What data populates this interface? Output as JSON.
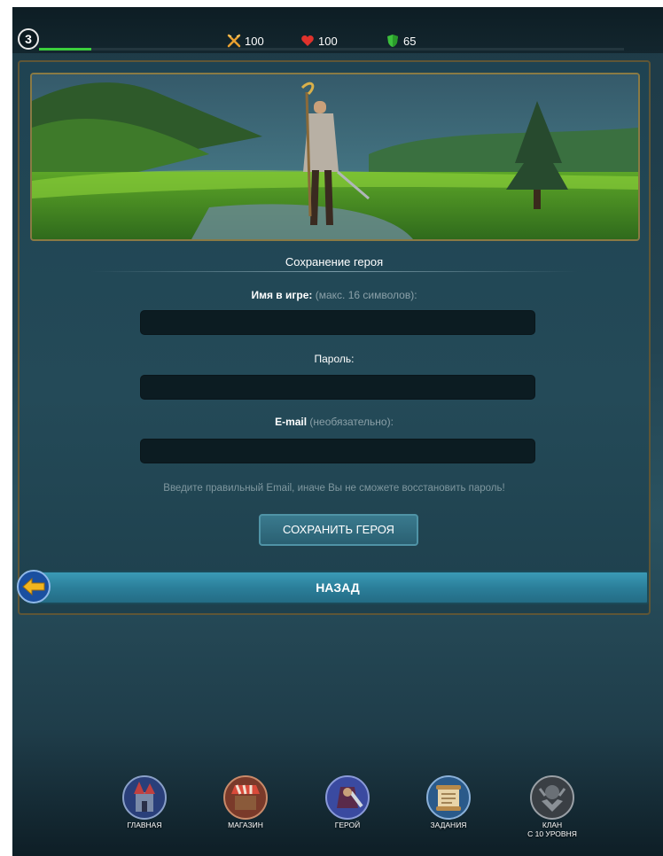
{
  "topbar": {
    "level": "3",
    "xp_progress": 0.09,
    "attack": "100",
    "health": "100",
    "defense": "65"
  },
  "form": {
    "title": "Сохранение героя",
    "name_label": "Имя в игре:",
    "name_hint": "(макс. 16 символов):",
    "name_value": "",
    "password_label": "Пароль:",
    "password_value": "",
    "email_label": "E-mail",
    "email_hint": "(необязательно):",
    "email_value": "",
    "warning": "Введите правильный Email, иначе Вы не сможете восстановить пароль!",
    "save_button": "СОХРАНИТЬ ГЕРОЯ"
  },
  "back_button": "НАЗАД",
  "nav": {
    "main": "ГЛАВНАЯ",
    "shop": "МАГАЗИН",
    "hero": "ГЕРОЙ",
    "quests": "ЗАДАНИЯ",
    "clan_line1": "КЛАН",
    "clan_line2": "С 10 УРОВНЯ"
  },
  "colors": {
    "accent": "#2b7f9a",
    "xp_green": "#3ccf3c",
    "panel_border": "#5f5636"
  },
  "icons": {
    "attack": "crossed-swords-icon",
    "health": "heart-icon",
    "defense": "shield-icon",
    "back": "back-arrow-icon"
  }
}
